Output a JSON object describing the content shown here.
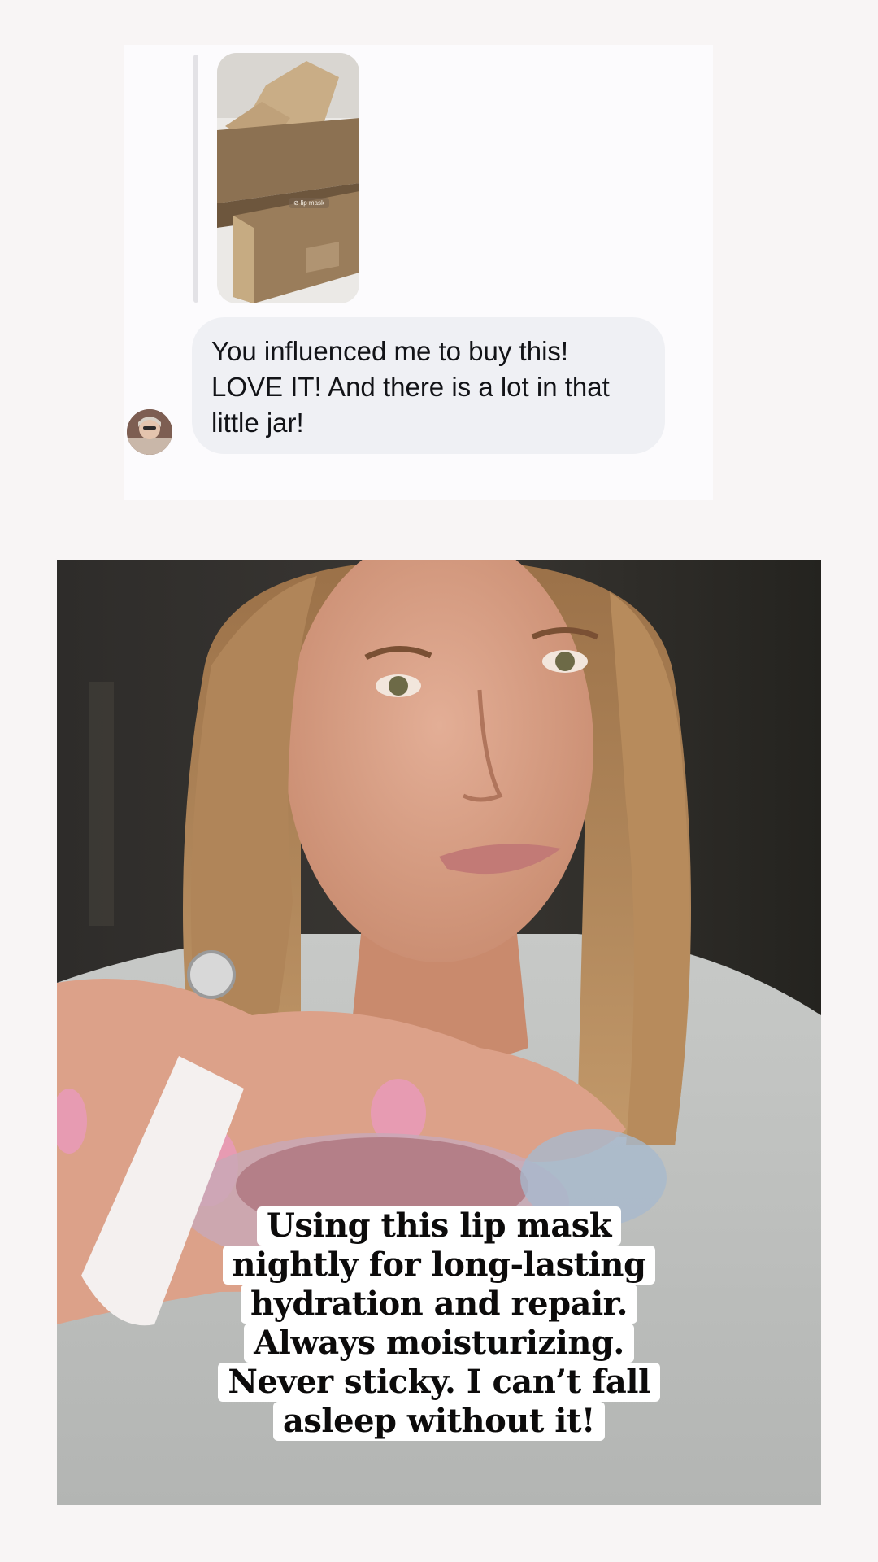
{
  "dm": {
    "shared_sticker_text": "lip mask",
    "sticker_icon": "link-icon",
    "message_lines": [
      "You influenced me to buy this!",
      "LOVE IT! And there is a lot in that",
      "little jar!"
    ]
  },
  "video": {
    "caption_lines": [
      "Using this lip mask",
      "nightly for long-lasting",
      "hydration and repair.",
      "Always moisturizing.",
      "Never sticky. I can’t fall",
      "asleep without it!"
    ]
  },
  "colors": {
    "page_background": "#f8f5f5",
    "bubble_background": "#eff0f4",
    "caption_background": "#ffffff"
  }
}
